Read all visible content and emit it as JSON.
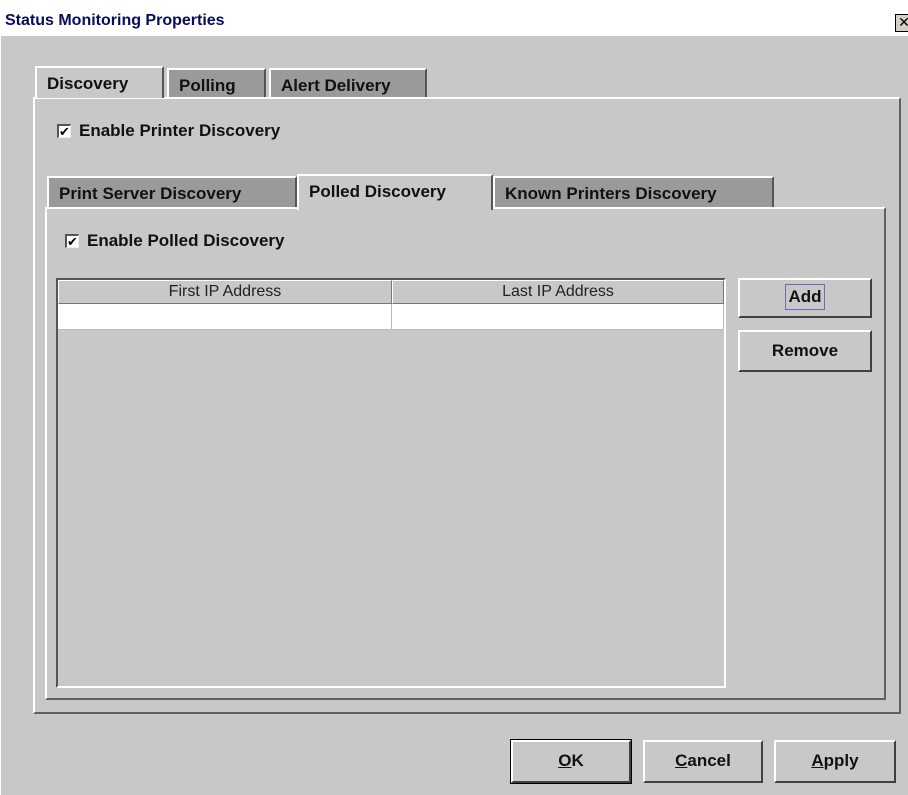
{
  "window": {
    "title": "Status Monitoring Properties",
    "close_glyph": "✕"
  },
  "main_tabs": [
    {
      "label": "Discovery",
      "active": true
    },
    {
      "label": "Polling",
      "active": false
    },
    {
      "label": "Alert Delivery",
      "active": false
    }
  ],
  "enable_printer_discovery": {
    "label": "Enable Printer Discovery",
    "checked": true,
    "check_glyph": "✔"
  },
  "sub_tabs": [
    {
      "label": "Print Server Discovery",
      "active": false
    },
    {
      "label": "Polled Discovery",
      "active": true
    },
    {
      "label": "Known Printers Discovery",
      "active": false
    }
  ],
  "enable_polled_discovery": {
    "label": "Enable Polled Discovery",
    "checked": true,
    "check_glyph": "✔"
  },
  "ip_table": {
    "columns": [
      "First IP Address",
      "Last IP Address"
    ],
    "rows": [
      [
        "",
        ""
      ]
    ]
  },
  "side_buttons": {
    "add": "Add",
    "remove": "Remove"
  },
  "footer_buttons": {
    "ok_mnemonic": "O",
    "ok_rest": "K",
    "cancel_mnemonic": "C",
    "cancel_rest": "ancel",
    "apply_mnemonic": "A",
    "apply_rest": "pply"
  },
  "colors": {
    "dialog_bg": "#c8c8c8",
    "inactive_tab": "#9a9a9a",
    "title_text": "#0a0a5a",
    "focus_border": "#6b6bb8"
  }
}
